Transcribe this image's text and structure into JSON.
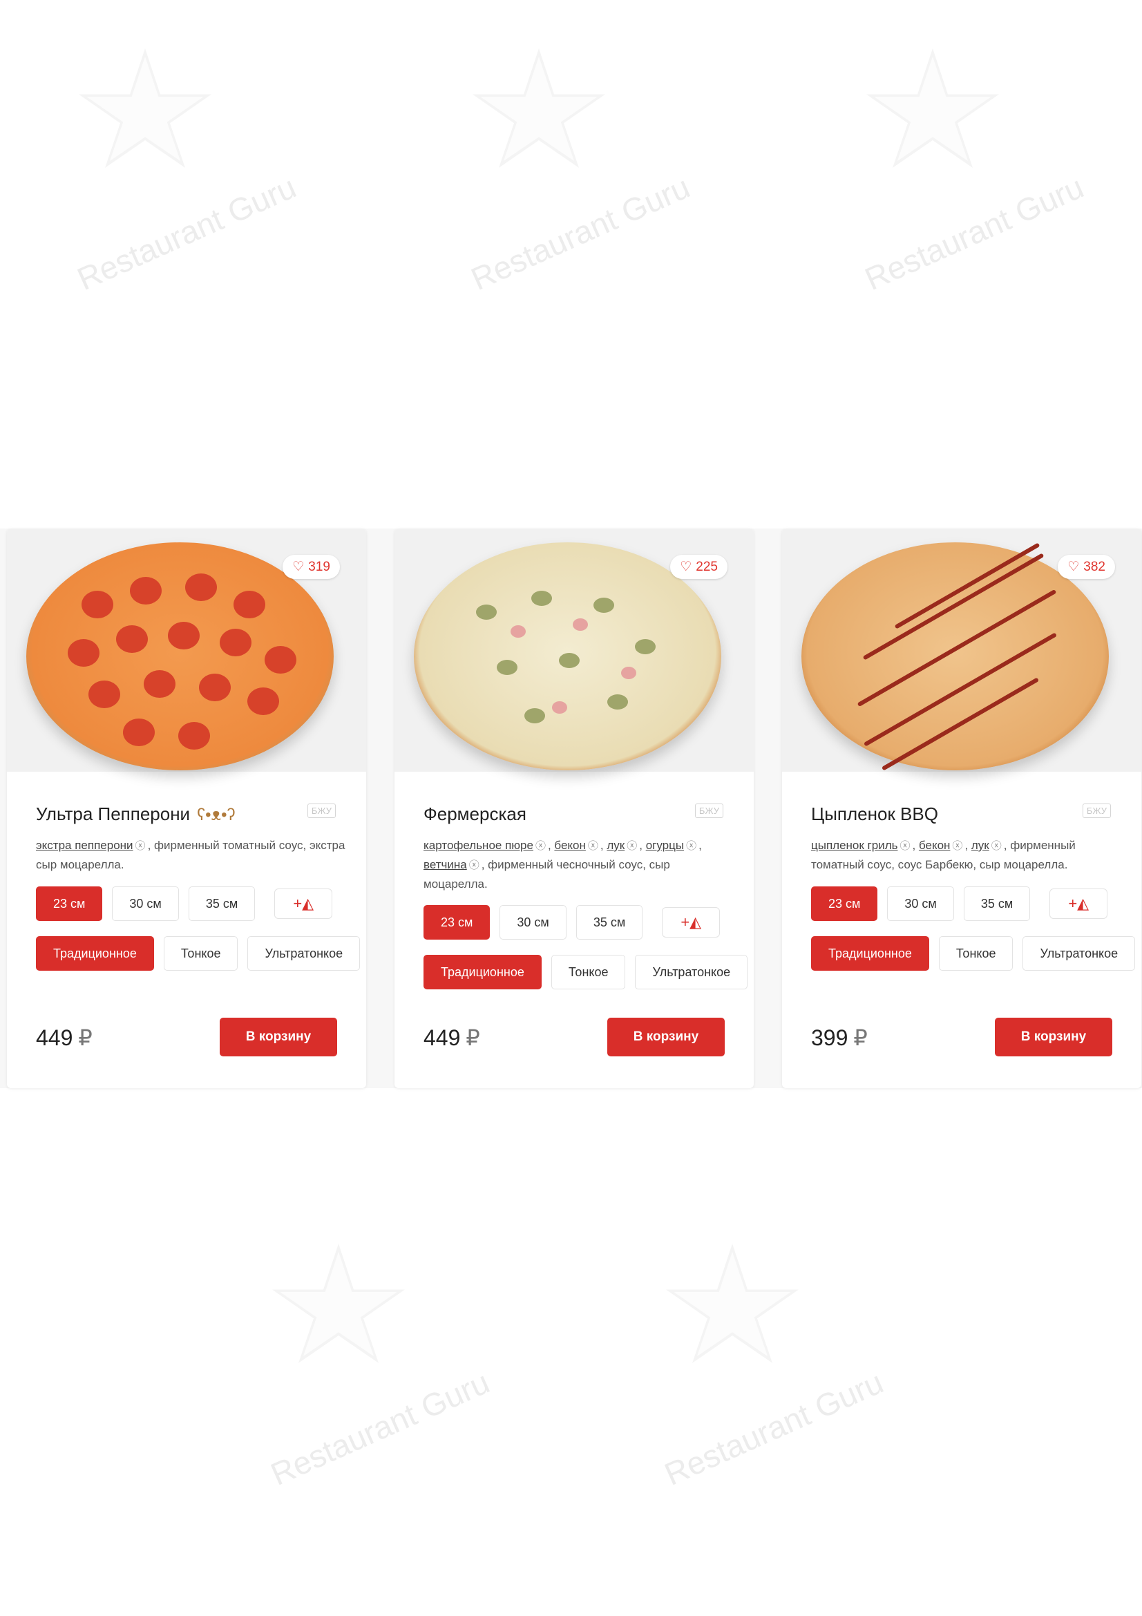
{
  "watermark": "Restaurant Guru",
  "cards": [
    {
      "name": "Ультра Пепперони",
      "extra_icon": "bear-icon",
      "likes": "319",
      "bju": "БЖУ",
      "desc_parts": [
        {
          "text": "экстра пепперони",
          "removable": true
        },
        {
          "text": ", фирменный томатный соус, экстра сыр моцарелла.",
          "removable": false
        }
      ],
      "sizes": [
        "23 см",
        "30 см",
        "35 см"
      ],
      "dough": [
        "Традиционное",
        "Тонкое",
        "Ультратонкое"
      ],
      "price": "449",
      "currency": "₽",
      "buy": "В корзину"
    },
    {
      "name": "Фермерская",
      "likes": "225",
      "bju": "БЖУ",
      "desc_parts": [
        {
          "text": "картофельное пюре",
          "removable": true
        },
        {
          "text": ", ",
          "removable": false
        },
        {
          "text": "бекон",
          "removable": true
        },
        {
          "text": ", ",
          "removable": false
        },
        {
          "text": "лук",
          "removable": true
        },
        {
          "text": ", ",
          "removable": false
        },
        {
          "text": "огурцы",
          "removable": true
        },
        {
          "text": ", ",
          "removable": false
        },
        {
          "text": "ветчина",
          "removable": true
        },
        {
          "text": ", фирменный чесночный соус, сыр моцарелла.",
          "removable": false
        }
      ],
      "sizes": [
        "23 см",
        "30 см",
        "35 см"
      ],
      "dough": [
        "Традиционное",
        "Тонкое",
        "Ультратонкое"
      ],
      "price": "449",
      "currency": "₽",
      "buy": "В корзину"
    },
    {
      "name": "Цыпленок BBQ",
      "likes": "382",
      "bju": "БЖУ",
      "desc_parts": [
        {
          "text": "цыпленок гриль",
          "removable": true
        },
        {
          "text": ", ",
          "removable": false
        },
        {
          "text": "бекон",
          "removable": true
        },
        {
          "text": ", ",
          "removable": false
        },
        {
          "text": "лук",
          "removable": true
        },
        {
          "text": ", фирменный томатный соус, соус Барбекю, сыр моцарелла.",
          "removable": false
        }
      ],
      "sizes": [
        "23 см",
        "30 см",
        "35 см"
      ],
      "dough": [
        "Традиционное",
        "Тонкое",
        "Ультратонкое"
      ],
      "price": "399",
      "currency": "₽",
      "buy": "В корзину"
    }
  ],
  "colors": {
    "accent": "#d92e2a"
  }
}
